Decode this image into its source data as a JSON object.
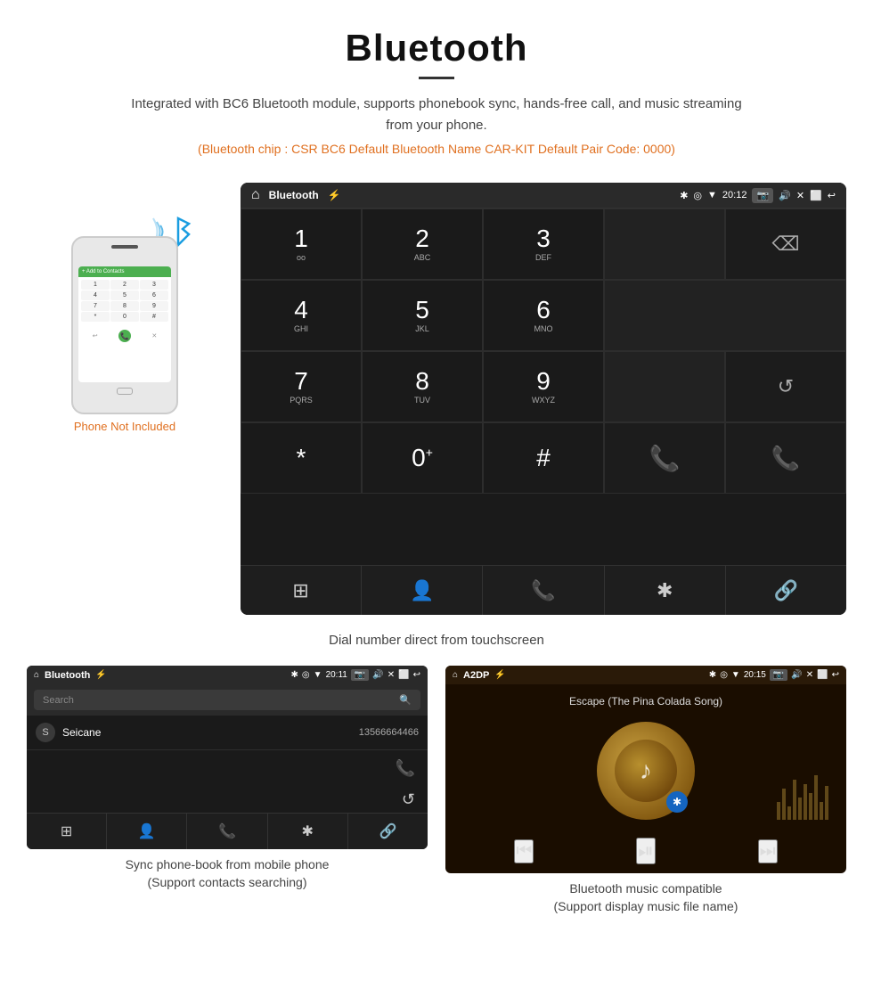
{
  "header": {
    "title": "Bluetooth",
    "description": "Integrated with BC6 Bluetooth module, supports phonebook sync, hands-free call, and music streaming from your phone.",
    "specs": "(Bluetooth chip : CSR BC6    Default Bluetooth Name CAR-KIT    Default Pair Code: 0000)"
  },
  "phone_section": {
    "not_included_label": "Phone Not Included"
  },
  "dialpad_screen": {
    "status_bar": {
      "title": "Bluetooth",
      "time": "20:12"
    },
    "keys": [
      {
        "number": "1",
        "letters": "oo"
      },
      {
        "number": "2",
        "letters": "ABC"
      },
      {
        "number": "3",
        "letters": "DEF"
      },
      {
        "number": "",
        "letters": ""
      },
      {
        "number": "⌫",
        "letters": ""
      },
      {
        "number": "4",
        "letters": "GHI"
      },
      {
        "number": "5",
        "letters": "JKL"
      },
      {
        "number": "6",
        "letters": "MNO"
      },
      {
        "number": "",
        "letters": ""
      },
      {
        "number": "",
        "letters": ""
      },
      {
        "number": "7",
        "letters": "PQRS"
      },
      {
        "number": "8",
        "letters": "TUV"
      },
      {
        "number": "9",
        "letters": "WXYZ"
      },
      {
        "number": "",
        "letters": ""
      },
      {
        "number": "↺",
        "letters": ""
      },
      {
        "number": "*",
        "letters": ""
      },
      {
        "number": "0",
        "letters": "+"
      },
      {
        "number": "#",
        "letters": ""
      },
      {
        "number": "📞",
        "letters": "green"
      },
      {
        "number": "📞",
        "letters": "red"
      }
    ],
    "nav_icons": [
      "⊞",
      "👤",
      "📞",
      "✱",
      "🔗"
    ]
  },
  "dial_caption": "Dial number direct from touchscreen",
  "phonebook_screen": {
    "status_bar": {
      "title": "Bluetooth",
      "time": "20:11"
    },
    "search_placeholder": "Search",
    "contacts": [
      {
        "letter": "S",
        "name": "Seicane",
        "number": "13566664466"
      }
    ],
    "nav_icons": [
      "⊞",
      "👤",
      "📞",
      "✱",
      "🔗"
    ]
  },
  "phonebook_caption": {
    "line1": "Sync phone-book from mobile phone",
    "line2": "(Support contacts searching)"
  },
  "music_screen": {
    "status_bar": {
      "title": "A2DP",
      "time": "20:15"
    },
    "song_title": "Escape (The Pina Colada Song)",
    "controls": [
      "⏮",
      "⏯",
      "⏭"
    ]
  },
  "music_caption": {
    "line1": "Bluetooth music compatible",
    "line2": "(Support display music file name)"
  }
}
